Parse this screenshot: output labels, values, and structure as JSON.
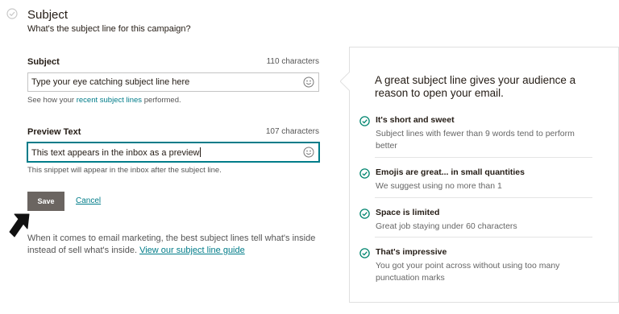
{
  "section": {
    "title": "Subject",
    "subtitle": "What's the subject line for this campaign?"
  },
  "subject": {
    "label": "Subject",
    "char_count": "110 characters",
    "value": "Type your eye catching subject line here",
    "help_prefix": "See how your",
    "help_link": "recent subject lines",
    "help_suffix": "performed."
  },
  "preview": {
    "label": "Preview Text",
    "char_count": "107 characters",
    "value": "This text appears in the inbox as a preview",
    "help": "This snippet will appear in the inbox after the subject line."
  },
  "actions": {
    "save_label": "Save",
    "cancel_label": "Cancel"
  },
  "footer": {
    "text": "When it comes to email marketing, the best subject lines tell what's inside instead of sell what's inside.",
    "link": "View our subject line guide"
  },
  "panel": {
    "heading": "A great subject line gives your audience a reason to open your email.",
    "tips": [
      {
        "title": "It's short and sweet",
        "desc": "Subject lines with fewer than 9 words tend to perform better"
      },
      {
        "title": "Emojis are great... in small quantities",
        "desc": "We suggest using no more than 1"
      },
      {
        "title": "Space is limited",
        "desc": "Great job staying under 60 characters"
      },
      {
        "title": "That's impressive",
        "desc": "You got your point across without using too many punctuation marks"
      }
    ]
  },
  "colors": {
    "accent": "#007c89",
    "check": "#00856f",
    "save_button": "#6b6561"
  },
  "icons": {
    "section_status": "check-circle-icon",
    "emoji_picker": "smiley-icon",
    "tip_status": "check-circle-icon",
    "pointer": "arrow-icon"
  }
}
